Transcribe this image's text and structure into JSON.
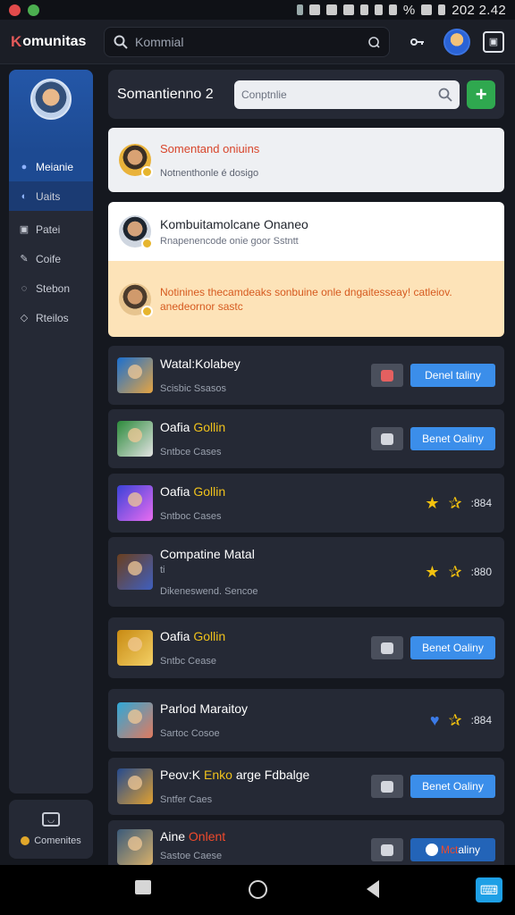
{
  "status_bar": {
    "time": "202 2.42",
    "battery_pct": "%",
    "colors": {
      "dot1": "#e24b4b",
      "dot2": "#4caf50"
    }
  },
  "app": {
    "logo_k": "K",
    "logo_rest": "omunitas",
    "search_placeholder": "Kommial"
  },
  "sidebar": {
    "items": [
      {
        "label": "Meianie",
        "icon": "e"
      },
      {
        "label": "Uaits",
        "icon": "c"
      },
      {
        "label": "Patei",
        "icon": "x"
      },
      {
        "label": "Coife",
        "icon": "/"
      },
      {
        "label": "Stebon",
        "icon": "o"
      },
      {
        "label": "Rteilos",
        "icon": "◇"
      }
    ],
    "footer_label": "Comenites"
  },
  "main": {
    "title": "Somantienno 2",
    "search_placeholder": "Conptnlie",
    "add_label": "+"
  },
  "notices": {
    "first": {
      "head": "Somentand oniuins",
      "sub": "Notnenthonle é dosigo"
    },
    "second": {
      "head": "Kombuitamolcane Onaneo",
      "sub": "Rnapenencode onie goor Sstntt",
      "alert_line1": "Notinines thecamdeaks sonbuine onle dngaitesseay! catleiov.",
      "alert_line2": "anedeornor sastc"
    }
  },
  "list": [
    {
      "name": "Watal:Kolabey",
      "meta": "Scisbic Ssasos",
      "action": "Denel taliny",
      "thumb": [
        "#1a6fd0",
        "#e6a441"
      ],
      "variant": "button",
      "mini_color": "red"
    },
    {
      "name_a": "Oafia ",
      "name_b": "Gollin",
      "meta": "Sntbce Cases",
      "action": "Benet Oaliny",
      "thumb": [
        "#2c8a3b",
        "#e3e3e3"
      ],
      "variant": "button"
    },
    {
      "name_a": "Oafia ",
      "name_b": "Gollin",
      "meta": "Sntboc Cases",
      "rating": ":884",
      "thumb": [
        "#3a42d8",
        "#e96cf0"
      ],
      "variant": "rating"
    },
    {
      "name": "Compatine Matal",
      "extra": "ti",
      "meta": "Dikeneswend. Sencoe",
      "rating": ":880",
      "thumb": [
        "#6b3f1e",
        "#3f5fbf"
      ],
      "variant": "rating"
    },
    {
      "name_a": "Oafia ",
      "name_b": "Gollin",
      "meta": "Sntbc Cease",
      "action": "Benet Oaliny",
      "thumb": [
        "#c88a12",
        "#f3d066"
      ],
      "variant": "button"
    },
    {
      "name": "Parlod Maraitoy",
      "meta": "Sartoc Cosoe",
      "rating": ":884",
      "thumb": [
        "#2fa8d8",
        "#e07a5f"
      ],
      "variant": "heart"
    },
    {
      "name_a": "Peov:K ",
      "name_b": "Enko",
      "name_c": " arge Fdbalge",
      "meta": "Sntfer Caes",
      "action": "Benet Oaliny",
      "thumb": [
        "#244a8f",
        "#e0a030"
      ],
      "variant": "button3"
    },
    {
      "name_a": "Aine ",
      "name_r": "Onlent",
      "meta": "Sastoe Caese",
      "action_hot": "Mct",
      "action_rest": "aliny",
      "thumb": [
        "#3a5a7a",
        "#d8b06a"
      ],
      "variant": "buttonhot"
    }
  ],
  "colors": {
    "accent": "#3b8eea",
    "add_green": "#2fa84f",
    "sidebar_active": "#1d4a92",
    "alert_bg": "#fde3b8",
    "alert_text": "#d65a1f",
    "star": "#f3c20f"
  }
}
